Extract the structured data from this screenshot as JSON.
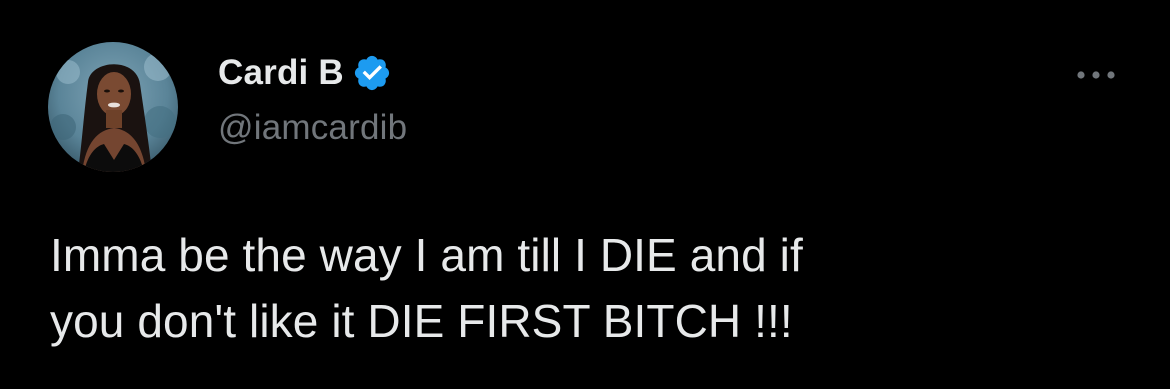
{
  "author": {
    "display_name": "Cardi B",
    "handle": "@iamcardib",
    "verified": true,
    "avatar_icon": "profile-photo",
    "verified_icon": "verified-badge-icon"
  },
  "more_icon": "more-options-icon",
  "tweet": {
    "lines": [
      "Imma be the way I am till I DIE and if",
      "you don't like it DIE FIRST BITCH !!!"
    ]
  },
  "colors": {
    "background": "#000000",
    "text_primary": "#e7e9ea",
    "text_secondary": "#71767b",
    "verified_blue": "#1d9bf0"
  }
}
